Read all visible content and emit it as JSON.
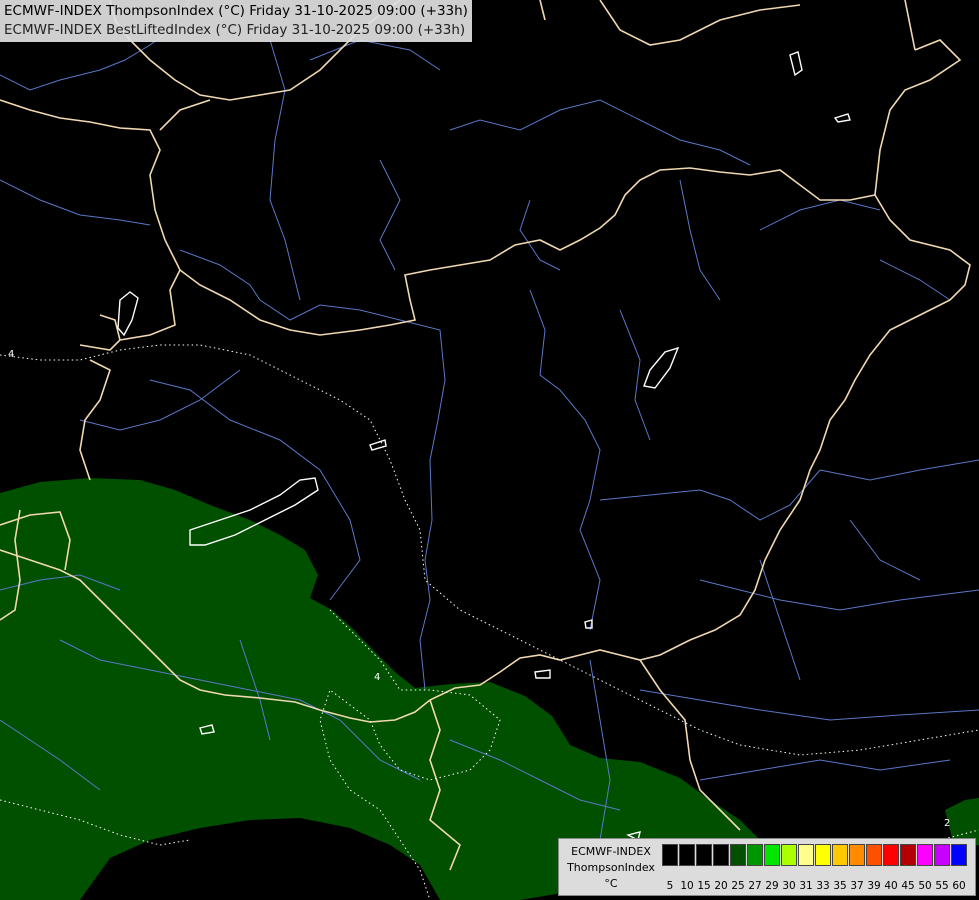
{
  "title": {
    "line1": "ECMWF-INDEX ThompsonIndex (°C) Friday 31-10-2025 09:00 (+33h)",
    "line2": "ECMWF-INDEX BestLiftedIndex (°C) Friday 31-10-2025 09:00 (+33h)"
  },
  "contour_labels": {
    "a": "4",
    "b": "4",
    "c": "2"
  },
  "legend": {
    "model": "ECMWF-INDEX",
    "parameter": "ThompsonIndex",
    "unit": "°C",
    "swatches": [
      {
        "color": "#000000",
        "label": "5"
      },
      {
        "color": "#000000",
        "label": "10"
      },
      {
        "color": "#000000",
        "label": "15"
      },
      {
        "color": "#000000",
        "label": "20"
      },
      {
        "color": "#005000",
        "label": "25"
      },
      {
        "color": "#009600",
        "label": "27"
      },
      {
        "color": "#00e600",
        "label": "29"
      },
      {
        "color": "#aaff00",
        "label": "30"
      },
      {
        "color": "#ffff8c",
        "label": "31"
      },
      {
        "color": "#ffff00",
        "label": "33"
      },
      {
        "color": "#ffc800",
        "label": "35"
      },
      {
        "color": "#ff8c00",
        "label": "37"
      },
      {
        "color": "#ff5000",
        "label": "39"
      },
      {
        "color": "#ff0000",
        "label": "40"
      },
      {
        "color": "#b40000",
        "label": "45"
      },
      {
        "color": "#ff00ff",
        "label": "50"
      },
      {
        "color": "#c800ff",
        "label": "55"
      },
      {
        "color": "#0000ff",
        "label": "60"
      }
    ]
  },
  "colors": {
    "background": "#000000",
    "fill_zone": "#005000",
    "borders": "#f0d8b0",
    "rivers": "#5a78c8",
    "lakes_coast": "#ffffff",
    "contours": "#ffffff"
  }
}
